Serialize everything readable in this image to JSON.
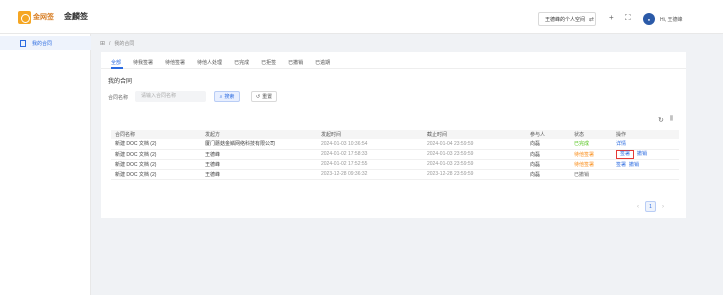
{
  "header": {
    "logo_text": "金网签",
    "app_title": "金麟签",
    "space_label": "王德峰的个人空间",
    "switch_icon": "⇄",
    "add_icon": "+",
    "fullscreen_icon": "⛶",
    "avatar_text": "●",
    "user_name": "Hi, 王德峰"
  },
  "sidebar": {
    "items": [
      {
        "label": "我的合同",
        "icon": "document-icon"
      }
    ]
  },
  "breadcrumb": {
    "grid_icon": "⊞",
    "separator": "/",
    "current": "我的合同"
  },
  "tabs": [
    "全部",
    "待我签署",
    "待他签署",
    "待他人处理",
    "已完成",
    "已拒签",
    "已撤销",
    "已逾期"
  ],
  "section_title": "我的合同",
  "filter": {
    "label": "合同名称",
    "placeholder": "请输入合同名称",
    "search_label": "搜索",
    "reset_label": "重置"
  },
  "toolbar": {
    "refresh_icon": "↻",
    "columns_icon": "⫼"
  },
  "table": {
    "columns": [
      "合同名称",
      "发起方",
      "发起时间",
      "截止时间",
      "参与人",
      "状态",
      "操作"
    ],
    "rows": [
      {
        "name": "新建 DOC 文档 (2)",
        "initiator": "厦门蘑菇金鳞网络科技有限公司",
        "start": "2024-01-03 10:36:54",
        "end": "2024-01-04 23:59:59",
        "participant": "向磊",
        "status": "已完成",
        "actions": [
          "详情"
        ]
      },
      {
        "name": "新建 DOC 文档 (2)",
        "initiator": "王德峰",
        "start": "2024-01-02 17:58:33",
        "end": "2024-01-03 23:59:59",
        "participant": "向磊",
        "status": "待他签署",
        "actions": [
          "签署",
          "撤销"
        ]
      },
      {
        "name": "新建 DOC 文档 (2)",
        "initiator": "王德峰",
        "start": "2024-01-02 17:52:55",
        "end": "2024-01-03 23:59:59",
        "participant": "向磊",
        "status": "待他签署",
        "actions": [
          "签署",
          "撤销"
        ]
      },
      {
        "name": "新建 DOC 文档 (2)",
        "initiator": "王德峰",
        "start": "2023-12-28 09:36:32",
        "end": "2023-12-28 23:59:59",
        "participant": "向磊",
        "status": "已撤销",
        "actions": []
      }
    ]
  },
  "pagination": {
    "prev": "‹",
    "current_page": "1",
    "next": "›"
  },
  "colors": {
    "primary": "#2b6be0",
    "success": "#52c41a",
    "warning": "#fa8c16",
    "highlight": "#e53935"
  }
}
